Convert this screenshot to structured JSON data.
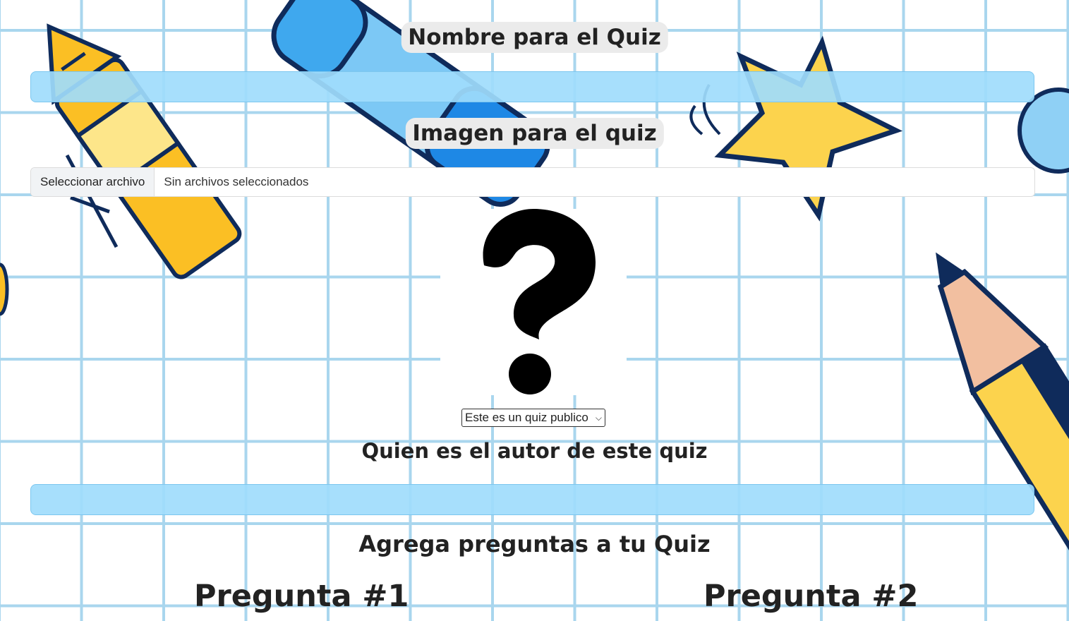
{
  "form": {
    "quiz_name_label": "Nombre para el Quiz",
    "quiz_name_value": "",
    "image_label": "Imagen para el quiz",
    "file_button_label": "Seleccionar archivo",
    "file_status": "Sin archivos seleccionados",
    "preview_icon": "question-mark-icon",
    "visibility_selected": "Este es un quiz publico",
    "author_label": "Quien es el autor de este quiz",
    "author_value": "",
    "questions_heading": "Agrega preguntas a tu Quiz"
  },
  "questions": [
    {
      "title": "Pregunta #1"
    },
    {
      "title": "Pregunta #2"
    }
  ],
  "colors": {
    "grid_line": "#a9d6ee",
    "input_fill": "#a0dcfc",
    "label_pill": "#ebebeb",
    "text": "#222222"
  }
}
